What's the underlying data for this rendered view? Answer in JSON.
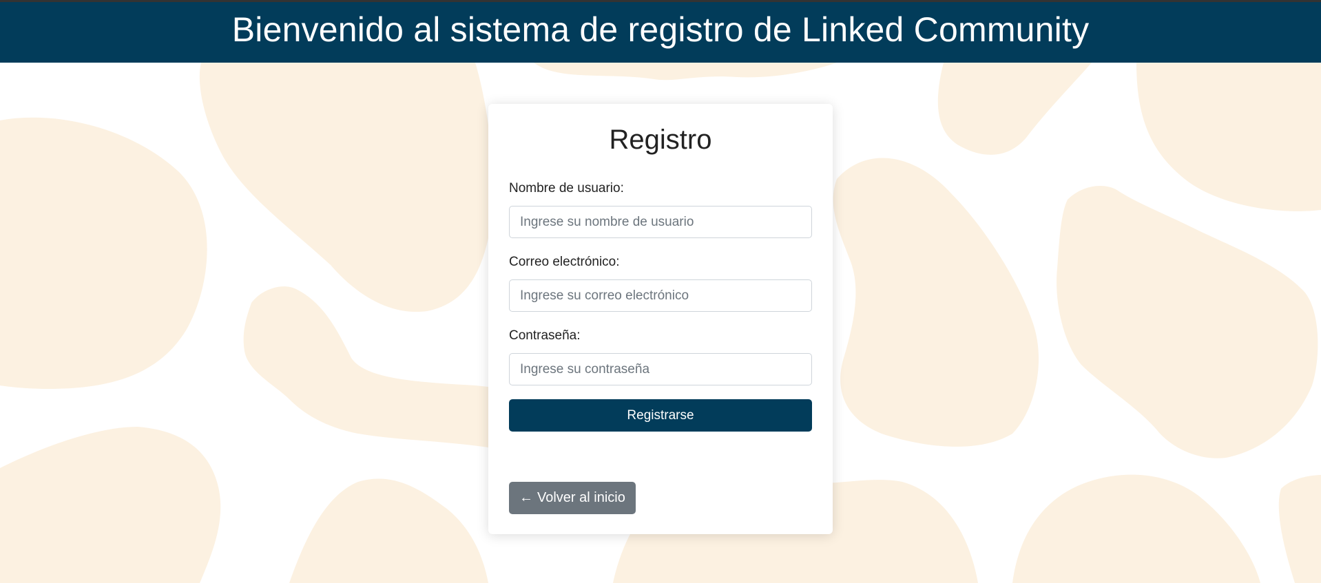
{
  "header": {
    "title": "Bienvenido al sistema de registro de Linked Community"
  },
  "colors": {
    "header_bg": "#023c5a",
    "blob": "#fcf1e1",
    "primary_button": "#023c5a",
    "secondary_button": "#6c757d"
  },
  "form": {
    "title": "Registro",
    "username": {
      "label": "Nombre de usuario:",
      "placeholder": "Ingrese su nombre de usuario"
    },
    "email": {
      "label": "Correo electrónico:",
      "placeholder": "Ingrese su correo electrónico"
    },
    "password": {
      "label": "Contraseña:",
      "placeholder": "Ingrese su contraseña"
    },
    "submit_label": "Registrarse",
    "back_label": "Volver al inicio",
    "back_icon": "arrow-left-icon"
  }
}
